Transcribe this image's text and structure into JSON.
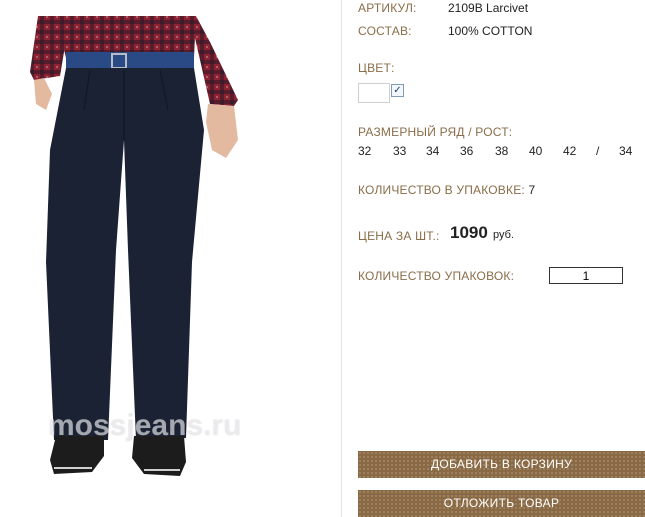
{
  "product": {
    "article_label": "АРТИКУЛ:",
    "article_value": "2109B Larcivet",
    "composition_label": "СОСТАВ:",
    "composition_value": "100% COTTON",
    "color_label": "ЦВЕТ:",
    "color_swatch": "#ffffff",
    "color_checked": "✓",
    "size_label": "РАЗМЕРНЫЙ РЯД / РОСТ:",
    "sizes": [
      "32",
      "33",
      "34",
      "36",
      "38",
      "40",
      "42",
      "/",
      "34"
    ],
    "pack_qty_label": "КОЛИЧЕСТВО В УПАКОВКЕ:",
    "pack_qty_value": "7",
    "price_label": "ЦЕНА ЗА ШТ.:",
    "price_value": "1090",
    "price_unit": "руб.",
    "packs_label": "КОЛИЧЕСТВО УПАКОВОК:",
    "packs_value": "1"
  },
  "actions": {
    "add_to_cart": "ДОБАВИТЬ В КОРЗИНУ",
    "postpone": "ОТЛОЖИТЬ ТОВАР"
  },
  "image": {
    "watermark": "mossjeans.ru"
  },
  "colors": {
    "label": "#8a6d49",
    "button": "#8a6a44",
    "pants": "#1a2233",
    "shirt": "#8e2230"
  }
}
